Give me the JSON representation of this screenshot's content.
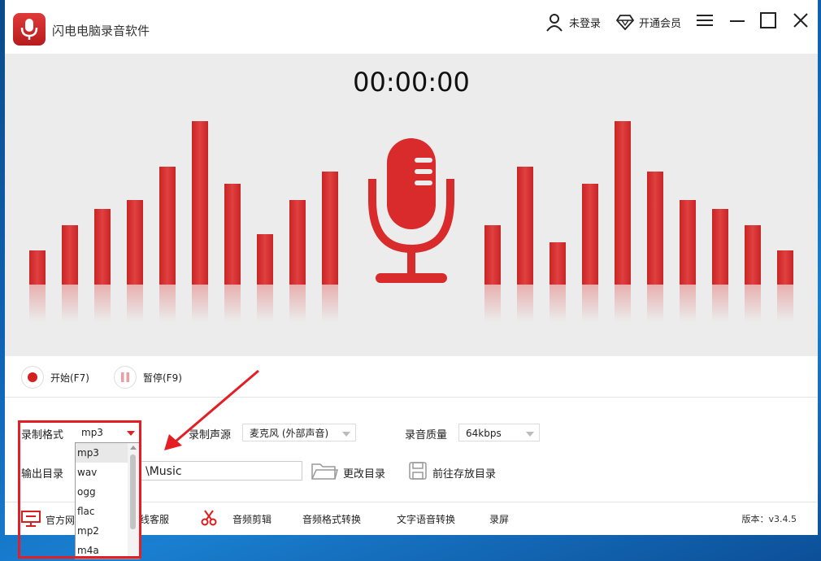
{
  "app": {
    "title": "闪电电脑录音软件"
  },
  "titlebar": {
    "login_label": "未登录",
    "vip_label": "开通会员",
    "icons": [
      "user-icon",
      "diamond-icon",
      "menu-icon",
      "minimize-icon",
      "maximize-icon",
      "close-icon"
    ]
  },
  "timer": {
    "value": "00:00:00"
  },
  "controls": {
    "start_label": "开始(F7)",
    "pause_label": "暂停(F9)"
  },
  "settings": {
    "format_label": "录制格式",
    "format_value": "mp3",
    "format_options": [
      "mp3",
      "wav",
      "ogg",
      "flac",
      "mp2",
      "m4a"
    ],
    "source_label": "录制声源",
    "source_value": "麦克风 (外部声音)",
    "quality_label": "录音质量",
    "quality_value": "64kbps",
    "output_label": "输出目录",
    "output_path": "\\Music",
    "change_dir_label": "更改目录",
    "open_dir_label": "前往存放目录"
  },
  "bottombar": {
    "official_label": "官方网",
    "support_label": "线客服",
    "audio_edit_label": "音频剪辑",
    "format_convert_label": "音频格式转换",
    "tts_label": "文字语音转换",
    "screen_record_label": "录屏",
    "version_label": "版本：v3.4.5"
  },
  "colors": {
    "accent": "#d32f2f",
    "highlight": "#e31e24",
    "background": "#ececec"
  }
}
